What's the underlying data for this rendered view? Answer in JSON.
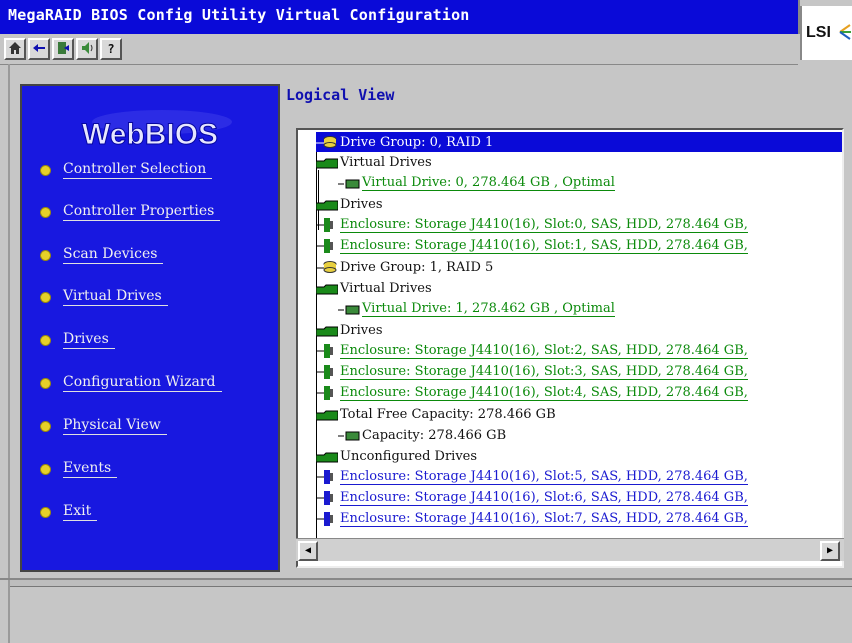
{
  "window": {
    "title": "MegaRAID BIOS Config Utility Virtual Configuration"
  },
  "toolbar": {
    "buttons": [
      {
        "icon": "home-icon"
      },
      {
        "icon": "back-arrow-icon"
      },
      {
        "icon": "exit-door-icon"
      },
      {
        "icon": "speaker-icon"
      },
      {
        "icon": "help-question-icon"
      }
    ]
  },
  "brand": {
    "logo": "LSI"
  },
  "sidebar": {
    "logo": "WebBIOS",
    "items": [
      {
        "label": "Controller Selection"
      },
      {
        "label": "Controller Properties"
      },
      {
        "label": "Scan Devices"
      },
      {
        "label": "Virtual Drives"
      },
      {
        "label": "Drives"
      },
      {
        "label": "Configuration Wizard"
      },
      {
        "label": "Physical View"
      },
      {
        "label": "Events"
      },
      {
        "label": "Exit"
      }
    ]
  },
  "main": {
    "title": "Logical View",
    "tree": [
      {
        "text": "Drive Group: 0, RAID 1",
        "style": "selected",
        "icon": "disk-group-icon"
      },
      {
        "text": "Virtual Drives",
        "style": "blk",
        "icon": "folder-icon"
      },
      {
        "text": "Virtual Drive: 0, 278.464 GB , Optimal",
        "style": "green",
        "icon": "virtual-drive-icon"
      },
      {
        "text": "Drives",
        "style": "blk",
        "icon": "folder-icon"
      },
      {
        "text": "Enclosure: Storage J4410(16), Slot:0, SAS, HDD, 278.464 GB,",
        "style": "green",
        "icon": "hdd-green-icon"
      },
      {
        "text": "Enclosure: Storage J4410(16), Slot:1, SAS, HDD, 278.464 GB,",
        "style": "green",
        "icon": "hdd-green-icon"
      },
      {
        "text": "Drive Group: 1, RAID 5",
        "style": "blk",
        "icon": "disk-group-icon"
      },
      {
        "text": "Virtual Drives",
        "style": "blk",
        "icon": "folder-icon"
      },
      {
        "text": "Virtual Drive: 1, 278.462 GB , Optimal",
        "style": "green",
        "icon": "virtual-drive-icon"
      },
      {
        "text": "Drives",
        "style": "blk",
        "icon": "folder-icon"
      },
      {
        "text": "Enclosure: Storage J4410(16), Slot:2, SAS, HDD, 278.464 GB,",
        "style": "green",
        "icon": "hdd-green-icon"
      },
      {
        "text": "Enclosure: Storage J4410(16), Slot:3, SAS, HDD, 278.464 GB,",
        "style": "green",
        "icon": "hdd-green-icon"
      },
      {
        "text": "Enclosure: Storage J4410(16), Slot:4, SAS, HDD, 278.464 GB,",
        "style": "green",
        "icon": "hdd-green-icon"
      },
      {
        "text": "Total Free Capacity: 278.466 GB",
        "style": "blk",
        "icon": "folder-icon"
      },
      {
        "text": "Capacity: 278.466 GB",
        "style": "blk",
        "icon": "capacity-icon"
      },
      {
        "text": "Unconfigured Drives",
        "style": "blk",
        "icon": "folder-icon"
      },
      {
        "text": "Enclosure: Storage J4410(16), Slot:5, SAS, HDD, 278.464 GB,",
        "style": "blue",
        "icon": "hdd-blue-icon"
      },
      {
        "text": "Enclosure: Storage J4410(16), Slot:6, SAS, HDD, 278.464 GB,",
        "style": "blue",
        "icon": "hdd-blue-icon"
      },
      {
        "text": "Enclosure: Storage J4410(16), Slot:7, SAS, HDD, 278.464 GB,",
        "style": "blue",
        "icon": "hdd-blue-icon"
      }
    ]
  },
  "colors": {
    "title_bar": "#0a0ad8",
    "sidebar_bg": "#1818e0",
    "menu_dot": "#e6d028",
    "ok_green": "#0b8a0b",
    "unconfigured_blue": "#1a1ad0"
  }
}
